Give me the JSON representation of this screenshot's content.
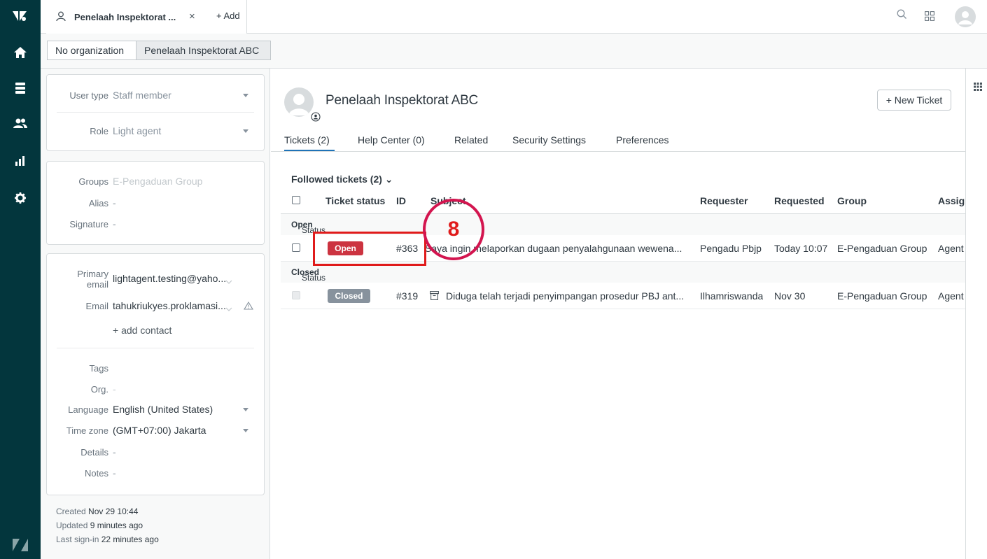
{
  "app": {
    "tab_title": "Penelaah Inspektorat ...",
    "tab_close": "×",
    "add_tab": "+ Add"
  },
  "breadcrumb": [
    "No organization",
    "Penelaah Inspektorat ABC"
  ],
  "user_fields": {
    "user_type": {
      "label": "User type",
      "value": "Staff member"
    },
    "role": {
      "label": "Role",
      "value": "Light agent"
    },
    "groups": {
      "label": "Groups",
      "value": "E-Pengaduan Group"
    },
    "alias": {
      "label": "Alias",
      "value": "-"
    },
    "signature": {
      "label": "Signature",
      "value": "-"
    },
    "primary_email": {
      "label_1": "Primary",
      "label_2": "email",
      "value": "lightagent.testing@yaho..."
    },
    "email": {
      "label": "Email",
      "value": "tahukriukyes.proklamasi..."
    },
    "add_contact": "+ add contact",
    "tags": {
      "label": "Tags",
      "value": ""
    },
    "org": {
      "label": "Org.",
      "value": "-"
    },
    "language": {
      "label": "Language",
      "value": "English (United States)"
    },
    "time_zone": {
      "label": "Time zone",
      "value": "(GMT+07:00) Jakarta"
    },
    "details": {
      "label": "Details",
      "value": "-"
    },
    "notes": {
      "label": "Notes",
      "value": "-"
    }
  },
  "meta": {
    "created_label": "Created",
    "created_value": "Nov 29 10:44",
    "updated_label": "Updated",
    "updated_value": "9 minutes ago",
    "last_signin_label": "Last sign-in",
    "last_signin_value": "22 minutes ago"
  },
  "profile": {
    "name": "Penelaah Inspektorat ABC",
    "new_ticket": "+ New Ticket",
    "tabs": [
      "Tickets (2)",
      "Help Center (0)",
      "Related",
      "Security Settings",
      "Preferences"
    ]
  },
  "tickets": {
    "followed": "Followed tickets (2) ⌄",
    "columns": {
      "status": "Ticket status",
      "id": "ID",
      "subject": "Subject",
      "requester": "Requester",
      "requested": "Requested",
      "group": "Group",
      "assignee": "Assig"
    },
    "open_category": {
      "prefix": "Status Category: ",
      "name": "Open"
    },
    "closed_category": {
      "prefix": "Status Category: ",
      "name": "Closed"
    },
    "rows": [
      {
        "status": "Open",
        "id": "#363",
        "subject": "Saya ingin melaporkan dugaan penyalahgunaan wewena...",
        "requester": "Pengadu Pbjp",
        "requested": "Today 10:07",
        "group": "E-Pengaduan Group",
        "assignee": "Agent"
      },
      {
        "status": "Closed",
        "id": "#319",
        "subject": "Diduga telah terjadi penyimpangan prosedur PBJ ant...",
        "requester": "Ilhamriswanda",
        "requested": "Nov 30",
        "group": "E-Pengaduan Group",
        "assignee": "Agent"
      }
    ]
  },
  "annotation": {
    "number": "8"
  },
  "colors": {
    "nav": "#03363d",
    "open_badge": "#cc3340",
    "closed_badge": "#87929d",
    "annotation_box": "#e01b1b",
    "annotation_circle": "#d3154f",
    "tab_underline": "#1f73b7"
  },
  "icons": {
    "logo": "zendesk-logo",
    "home": "home-icon",
    "views": "views-icon",
    "customers": "customers-icon",
    "reporting": "reporting-icon",
    "admin": "gear-icon",
    "search": "search-icon",
    "products": "grid-icon",
    "profile": "avatar-icon",
    "apps": "apps-icon"
  }
}
